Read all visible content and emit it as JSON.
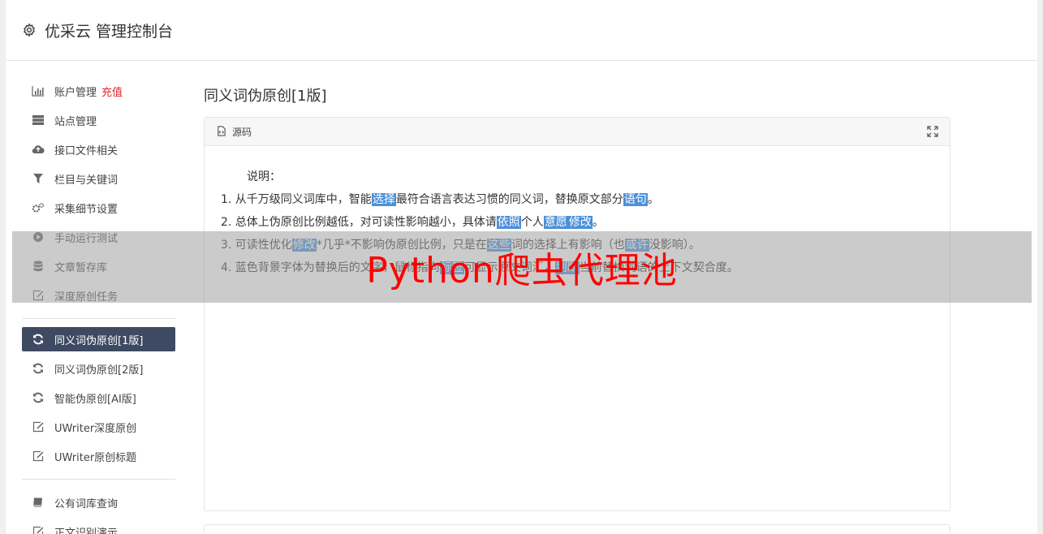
{
  "header": {
    "title": "优采云 管理控制台",
    "icon": "gear-icon"
  },
  "sidebar": {
    "group1": [
      {
        "label": "账户管理",
        "icon": "bar-chart-icon",
        "badge": "充值"
      },
      {
        "label": "站点管理",
        "icon": "server-icon"
      },
      {
        "label": "接口文件相关",
        "icon": "cloud-upload-icon"
      },
      {
        "label": "栏目与关键词",
        "icon": "filter-icon"
      },
      {
        "label": "采集细节设置",
        "icon": "cogs-icon"
      },
      {
        "label": "手动运行测试",
        "icon": "play-circle-icon"
      },
      {
        "label": "文章暂存库",
        "icon": "database-icon"
      },
      {
        "label": "深度原创任务",
        "icon": "edit-icon"
      }
    ],
    "group2": [
      {
        "label": "同义词伪原创[1版]",
        "icon": "refresh-icon",
        "active": true
      },
      {
        "label": "同义词伪原创[2版]",
        "icon": "refresh-icon"
      },
      {
        "label": "智能伪原创[AI版]",
        "icon": "refresh-icon"
      },
      {
        "label": "UWriter深度原创",
        "icon": "edit-icon"
      },
      {
        "label": "UWriter原创标题",
        "icon": "edit-icon"
      }
    ],
    "group3": [
      {
        "label": "公有词库查询",
        "icon": "book-icon"
      },
      {
        "label": "正文识别演示",
        "icon": "edit-icon"
      }
    ]
  },
  "main": {
    "page_title": "同义词伪原创[1版]",
    "panel": {
      "title": "源码",
      "intro": "说明：",
      "lines": [
        [
          {
            "t": "1. 从千万级同义词库中，智能"
          },
          {
            "t": "选择",
            "hl": true
          },
          {
            "t": "最符合语言表达习惯的同义词，替换原文部分"
          },
          {
            "t": "语句",
            "hl": true
          },
          {
            "t": "。"
          }
        ],
        [
          {
            "t": "2. 总体上伪原创比例越低，对可读性影响越小，具体请"
          },
          {
            "t": "依照",
            "hl": true
          },
          {
            "t": "个人"
          },
          {
            "t": "意愿",
            "hl": true
          },
          {
            "t": "修改",
            "hl": true
          },
          {
            "t": "。"
          }
        ],
        [
          {
            "t": "3. 可读性优化"
          },
          {
            "t": "修改",
            "hl": true
          },
          {
            "t": "*几乎*不影响伪原创比例，只是在"
          },
          {
            "t": "这些",
            "hl": true
          },
          {
            "t": "词的选择上有影响（也"
          },
          {
            "t": "或许",
            "hl": true
          },
          {
            "t": "没影响）。"
          }
        ],
        [
          {
            "t": "4. 蓝色背景字体为替换后的文字，鼠标指向"
          },
          {
            "t": "标签",
            "hl": true
          },
          {
            "t": "可显示原文词汇，"
          },
          {
            "t": "判断",
            "hl": true
          },
          {
            "t": "当前替换词语的上下文契合度。"
          }
        ]
      ]
    }
  },
  "watermark": "Python爬虫代理池",
  "colors": {
    "sidebar_active": "#3d4a61",
    "highlight": "#4a90d9",
    "badge": "#e02424",
    "watermark": "#ff0000"
  }
}
